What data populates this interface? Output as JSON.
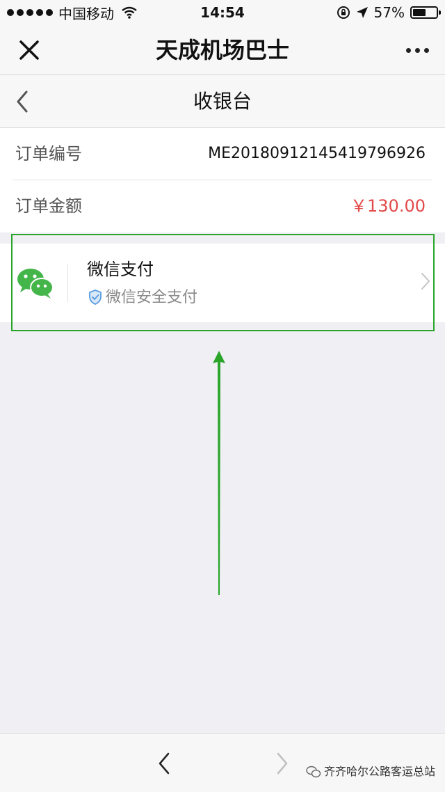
{
  "status_bar": {
    "carrier": "中国移动",
    "time": "14:54",
    "battery_percent": "57%",
    "battery_level": 0.57
  },
  "nav": {
    "title": "天成机场巴士"
  },
  "page": {
    "title": "收银台"
  },
  "order": {
    "number_label": "订单编号",
    "number_value": "ME20180912145419796926",
    "amount_label": "订单金额",
    "amount_value": "￥130.00"
  },
  "payment": {
    "method_title": "微信支付",
    "method_subtitle": "微信安全支付"
  },
  "watermark": {
    "text": "齐齐哈尔公路客运总站"
  },
  "colors": {
    "highlight": "#2aa52a",
    "amount": "#e24a4a",
    "wechat_green": "#44b549",
    "shield": "#5a9de0"
  },
  "icons": [
    "close-icon",
    "more-icon",
    "back-icon",
    "wechat-icon",
    "shield-icon",
    "chevron-right-icon",
    "forward-icon"
  ]
}
